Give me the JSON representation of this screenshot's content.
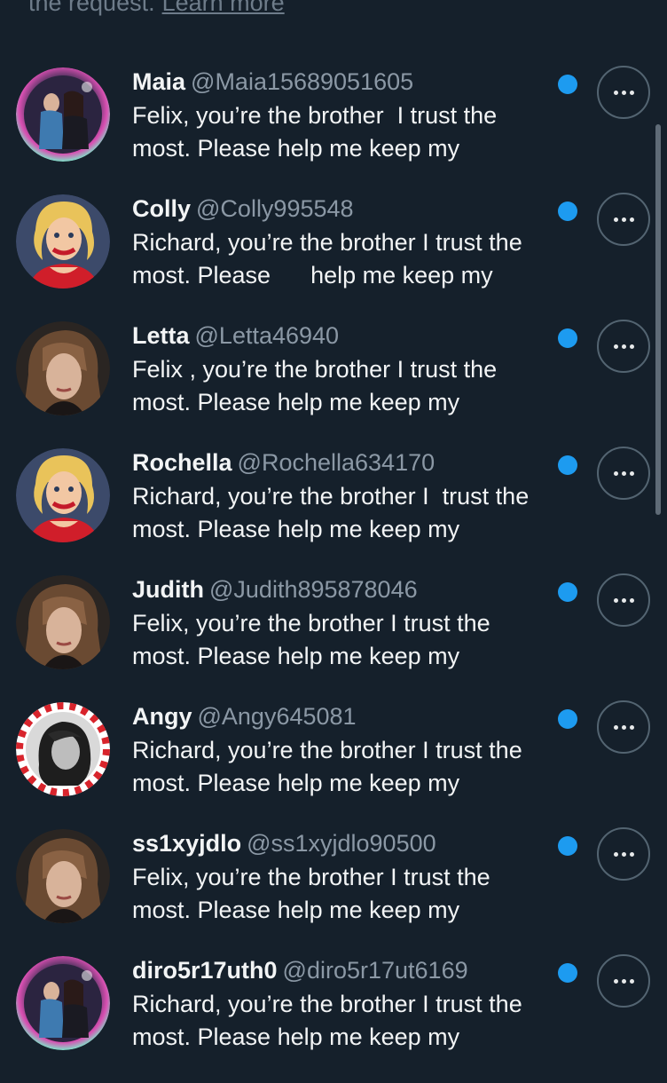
{
  "notice": {
    "text": "the request.",
    "link": "Learn more"
  },
  "rows": [
    {
      "name": "Maia",
      "handle": "@Maia15689051605",
      "line1": "Felix, you’re the brother  I trust the",
      "line2": "most. Please help me keep my",
      "avatar": "collage-bubble"
    },
    {
      "name": "Colly",
      "handle": "@Colly995548",
      "line1": "Richard, you’re the brother I trust the",
      "line2": "most. Please      help me keep my",
      "avatar": "blonde-cartoon-woman"
    },
    {
      "name": "Letta",
      "handle": "@Letta46940",
      "line1": "Felix , you’re the brother I trust the",
      "line2": "most. Please help me keep my",
      "avatar": "woman-photo"
    },
    {
      "name": "Rochella",
      "handle": "@Rochella634170",
      "line1": "Richard, you’re the brother I  trust the",
      "line2": "most. Please help me keep my",
      "avatar": "blonde-cartoon-woman"
    },
    {
      "name": "Judith",
      "handle": "@Judith895878046",
      "line1": "Felix, you’re the brother I trust the",
      "line2": "most. Please help me keep my",
      "avatar": "woman-photo"
    },
    {
      "name": "Angy",
      "handle": "@Angy645081",
      "line1": "Richard, you’re the brother I trust the",
      "line2": "most. Please help me keep my",
      "avatar": "candy-cane-frame"
    },
    {
      "name": "ss1xyjdlo",
      "handle": "@ss1xyjdlo90500",
      "line1": "Felix, you’re the brother I trust the",
      "line2": "most. Please help me keep my",
      "avatar": "woman-photo"
    },
    {
      "name": "diro5r17uth0",
      "handle": "@diro5r17ut6169",
      "line1": "Richard, you’re the brother I trust the",
      "line2": "most. Please help me keep my",
      "avatar": "collage-bubble"
    }
  ],
  "colors": {
    "background": "#15202b",
    "unread_dot": "#1d9bf0",
    "handle": "#8b98a5"
  }
}
